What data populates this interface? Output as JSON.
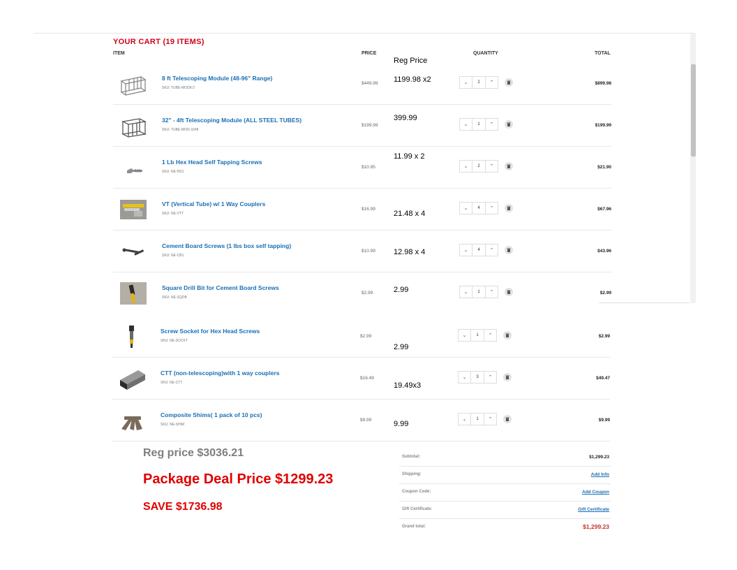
{
  "cart": {
    "title": "YOUR CART (19 ITEMS)",
    "columns": {
      "item": "ITEM",
      "price": "PRICE",
      "quantity": "QUANTITY",
      "total": "TOTAL"
    },
    "reg_price_header": "Reg Price",
    "items": [
      {
        "name": "8 ft Telescoping Module (48-96\" Range)",
        "sku": "SKU: TUBE-MOD8-2",
        "price": "$449.99",
        "qty": "2",
        "total": "$899.98",
        "reg_note": "1199.98 x2",
        "icon": "telescoping-module-icon"
      },
      {
        "name": "32\" - 4ft Telescoping Module (ALL STEEL TUBES)",
        "sku": "SKU: TUBE-MOD-3248",
        "price": "$199.99",
        "qty": "1",
        "total": "$199.99",
        "reg_note": "399.99",
        "icon": "steel-module-icon"
      },
      {
        "name": "1 Lb Hex Head Self Tapping Screws",
        "sku": "SKU: NE-HS1",
        "price": "$10.95",
        "qty": "2",
        "total": "$21.90",
        "reg_note": "11.99 x 2",
        "icon": "hex-screw-icon"
      },
      {
        "name": "VT (Vertical Tube) w/ 1 Way Couplers",
        "sku": "SKU: NE-VTT",
        "price": "$16.99",
        "qty": "4",
        "total": "$67.96",
        "reg_note": "21.48 x 4",
        "icon": "vertical-tube-icon"
      },
      {
        "name": "Cement Board Screws (1 lbs box self tapping)",
        "sku": "SKU: NE-CB1",
        "price": "$10.99",
        "qty": "4",
        "total": "$43.96",
        "reg_note": "12.98 x 4",
        "icon": "cement-screw-icon"
      },
      {
        "name": "Square Drill Bit for Cement Board Screws",
        "sku": "SKU: NE-SQDB",
        "price": "$2.99",
        "qty": "1",
        "total": "$2.99",
        "reg_note": "2.99",
        "icon": "drill-bit-icon"
      },
      {
        "name": "Screw Socket for Hex Head Screws",
        "sku": "SKU: NE-SOCKT",
        "price": "$2.99",
        "qty": "1",
        "total": "$2.99",
        "reg_note": "2.99",
        "icon": "screw-socket-icon"
      },
      {
        "name": "CTT (non-telescoping)with 1 way couplers",
        "sku": "SKU: NE-CTT",
        "price": "$16.49",
        "qty": "3",
        "total": "$49.47",
        "reg_note": "19.49x3",
        "icon": "square-tube-icon"
      },
      {
        "name": "Composite Shims( 1 pack of 10 pcs)",
        "sku": "SKU: NE-SHIM",
        "price": "$9.99",
        "qty": "1",
        "total": "$9.99",
        "reg_note": "9.99",
        "icon": "shims-icon"
      }
    ]
  },
  "deal": {
    "reg_price": "Reg price $3036.21",
    "package_price": "Package  Deal Price $1299.23",
    "save": "SAVE $1736.98"
  },
  "summary": {
    "subtotal_label": "Subtotal:",
    "subtotal": "$1,299.23",
    "shipping_label": "Shipping:",
    "shipping_link": "Add Info",
    "coupon_label": "Coupon Code:",
    "coupon_link": "Add Coupon",
    "gift_label": "Gift Certificate:",
    "gift_link": "Gift Certificate",
    "grand_label": "Grand total:",
    "grand_total": "$1,299.23"
  },
  "colors": {
    "title_red": "#d0021b",
    "link_blue": "#1a6fb3",
    "deal_red": "#e00000",
    "reg_gray": "#7f7f7f"
  }
}
